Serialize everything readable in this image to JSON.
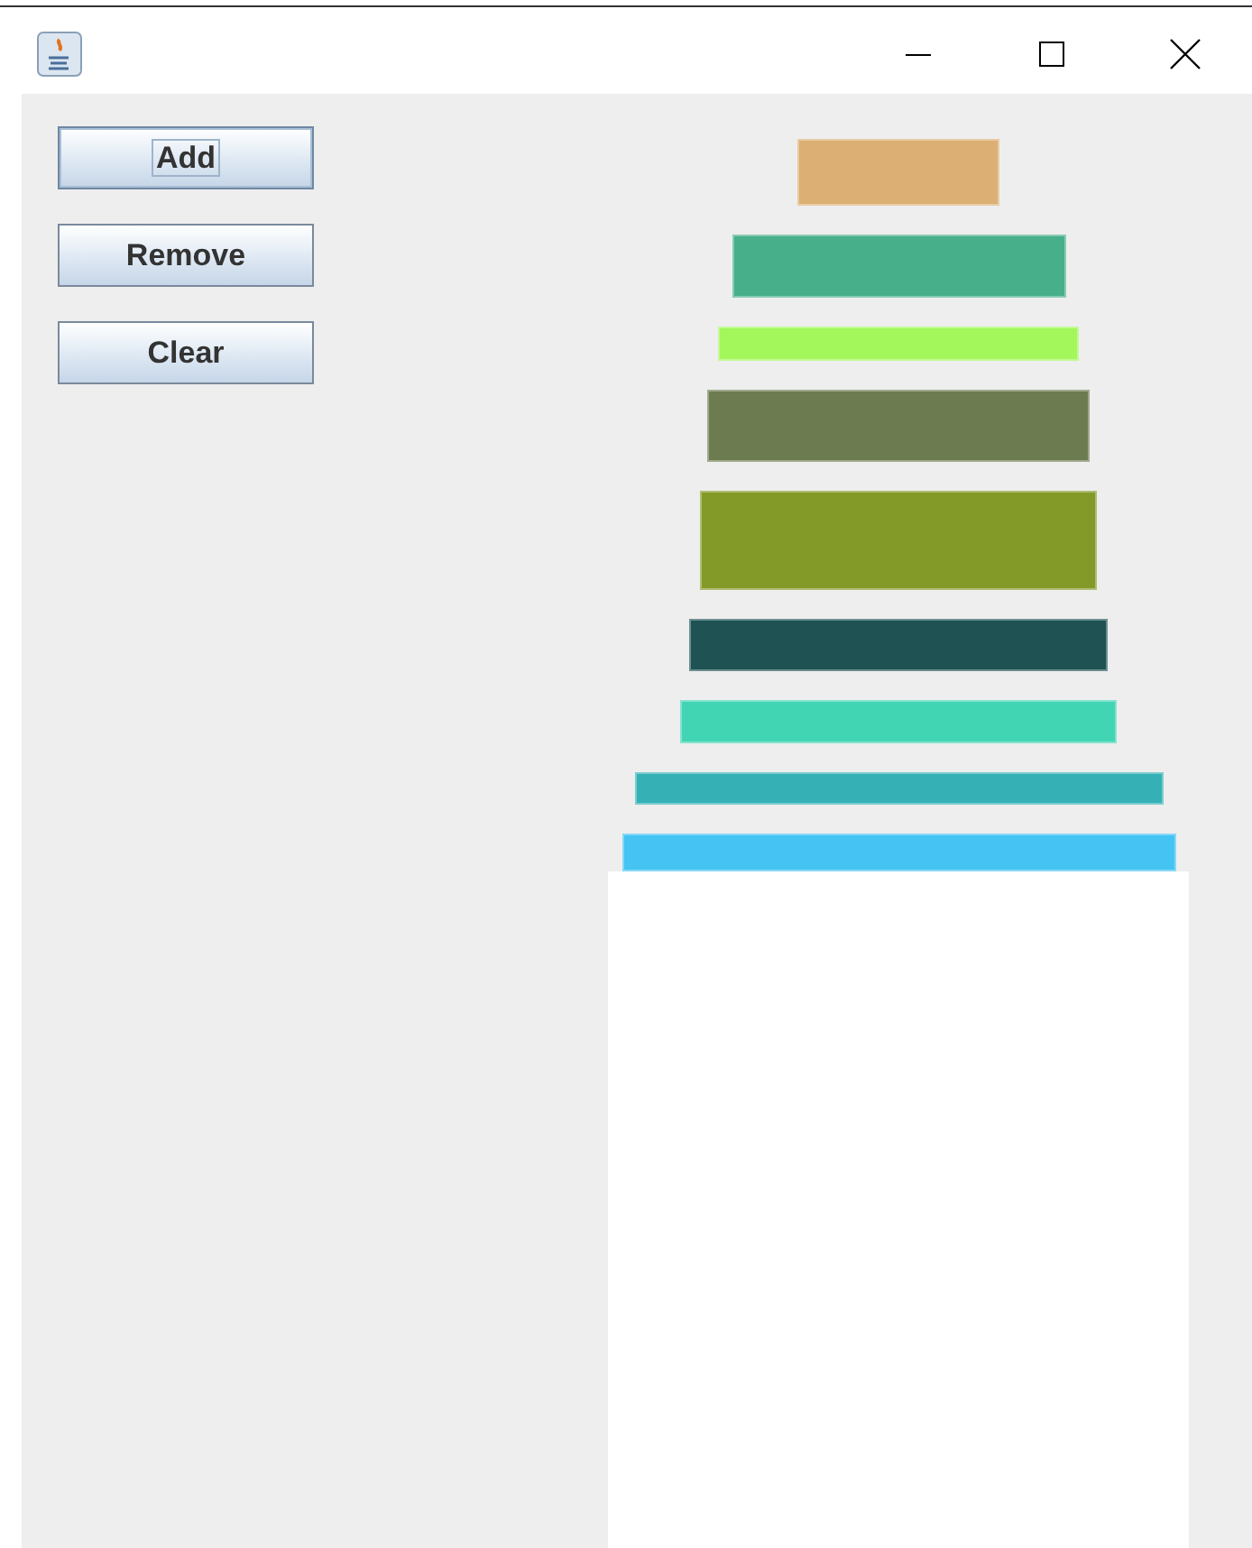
{
  "buttons": [
    {
      "label": "Add",
      "focused": true
    },
    {
      "label": "Remove",
      "focused": false
    },
    {
      "label": "Clear",
      "focused": false
    }
  ],
  "blocks": [
    {
      "color": "#dcaf74"
    },
    {
      "color": "#48af8b"
    },
    {
      "color": "#a3f75b"
    },
    {
      "color": "#6d7c50"
    },
    {
      "color": "#839a29"
    },
    {
      "color": "#1e5253"
    },
    {
      "color": "#42d5b4"
    },
    {
      "color": "#35b1b6"
    },
    {
      "color": "#45c3f2"
    }
  ]
}
